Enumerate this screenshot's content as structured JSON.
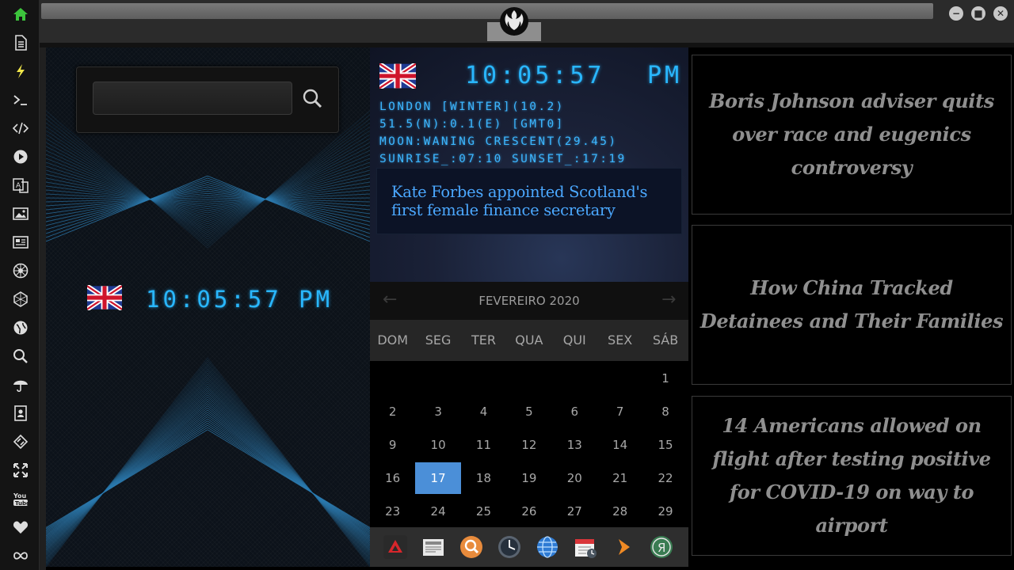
{
  "search": {
    "placeholder": "",
    "value": ""
  },
  "clock": {
    "time": "10:05:57",
    "ampm": "PM",
    "left_time": "10:05:57  PM"
  },
  "location_info": [
    "LONDON [WINTER](10.2)",
    "51.5(N):0.1(E) [GMT0]",
    "MOON:WANING CRESCENT(29.45)",
    "SUNRISE_:07:10 SUNSET_:17:19"
  ],
  "headline": {
    "line1": "Kate Forbes appointed Scotland's",
    "line2": "first female finance secretary"
  },
  "calendar": {
    "title": "FEVEREIRO 2020",
    "prev": "←",
    "next": "→",
    "weekdays": [
      "DOM",
      "SEG",
      "TER",
      "QUA",
      "QUI",
      "SEX",
      "SÁB"
    ],
    "days": [
      "",
      "",
      "",
      "",
      "",
      "",
      "1",
      "2",
      "3",
      "4",
      "5",
      "6",
      "7",
      "8",
      "9",
      "10",
      "11",
      "12",
      "13",
      "14",
      "15",
      "16",
      "17",
      "18",
      "19",
      "20",
      "21",
      "22",
      "23",
      "24",
      "25",
      "26",
      "27",
      "28",
      "29"
    ],
    "today": "17",
    "today_color": "#4b8fd8"
  },
  "news": [
    "Boris Johnson adviser quits over race and eugenics controversy",
    "How China Tracked Detainees and Their Families",
    "14 Americans allowed on flight after testing positive for COVID-19 on way to airport"
  ],
  "sidebar_icons": [
    "home-icon",
    "document-icon",
    "lightning-icon",
    "terminal-icon",
    "code-icon",
    "play-icon",
    "translate-icon",
    "image-icon",
    "newspaper-icon",
    "rebel-icon",
    "hexagon-icon",
    "globe-icon",
    "search-icon",
    "umbrella-icon",
    "contacts-icon",
    "tag-icon",
    "expand-icon",
    "youtube-icon",
    "heart-icon",
    "infinity-icon"
  ],
  "dock_apps": [
    "ardour-app-icon",
    "news-app-icon",
    "search-app-icon",
    "clock-app-icon",
    "globe-app-icon",
    "calendar-app-icon",
    "arrow-app-icon",
    "yandex-app-icon"
  ],
  "colors": {
    "accent_green": "#3cc43c",
    "clock_blue": "#29b7ff",
    "headline_blue": "#4ba8ff"
  }
}
